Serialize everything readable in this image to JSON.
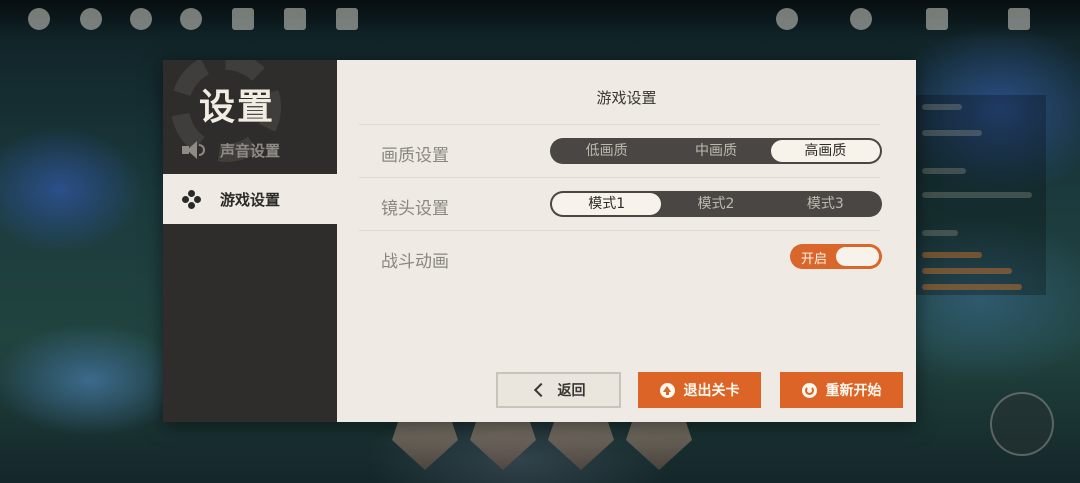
{
  "sidebar": {
    "title": "设置",
    "items": [
      {
        "label": "声音设置",
        "icon": "speaker-icon",
        "active": false
      },
      {
        "label": "游戏设置",
        "icon": "gamepad-icon",
        "active": true
      }
    ]
  },
  "content": {
    "title": "游戏设置",
    "rows": [
      {
        "label": "画质设置",
        "options": [
          "低画质",
          "中画质",
          "高画质"
        ],
        "selected": "高画质"
      },
      {
        "label": "镜头设置",
        "options": [
          "模式1",
          "模式2",
          "模式3"
        ],
        "selected": "模式1"
      },
      {
        "label": "战斗动画",
        "toggle_label": "开启",
        "toggle_on": true
      }
    ]
  },
  "buttons": {
    "back": "返回",
    "exit": "退出关卡",
    "restart": "重新开始"
  },
  "colors": {
    "accent": "#db6426",
    "sidebar_bg": "#2e2d2b",
    "panel_bg": "#efebe4",
    "segment_bg": "#4a4643"
  }
}
